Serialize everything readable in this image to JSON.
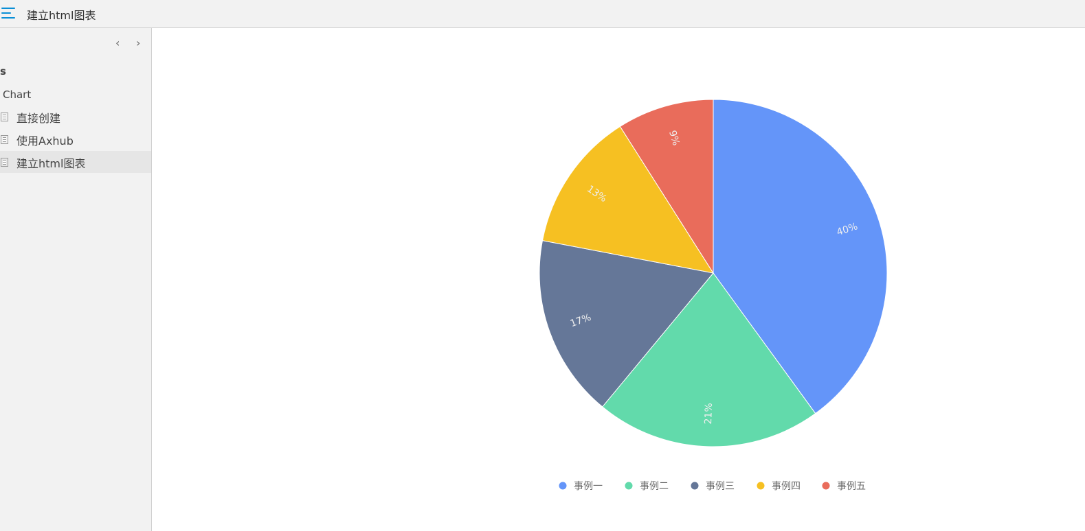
{
  "header": {
    "title": "建立html图表",
    "menu_icon": "hamburger-menu-icon"
  },
  "sidebar": {
    "section_partial": "s",
    "group": "Chart",
    "items": [
      {
        "label": "直接创建"
      },
      {
        "label": "使用Axhub"
      },
      {
        "label": "建立html图表",
        "selected": true
      }
    ]
  },
  "chart_data": {
    "type": "pie",
    "start": "top",
    "direction": "clockwise",
    "labels": "percent, inside, radial",
    "legend_position": "bottom",
    "categories": [
      "事例一",
      "事例二",
      "事例三",
      "事例四",
      "事例五"
    ],
    "values": [
      40,
      21,
      17,
      13,
      9
    ],
    "value_labels": [
      "40%",
      "21%",
      "17%",
      "13%",
      "9%"
    ],
    "colors": [
      "#6495f9",
      "#62daab",
      "#657798",
      "#f6c022",
      "#e96c5b"
    ]
  }
}
